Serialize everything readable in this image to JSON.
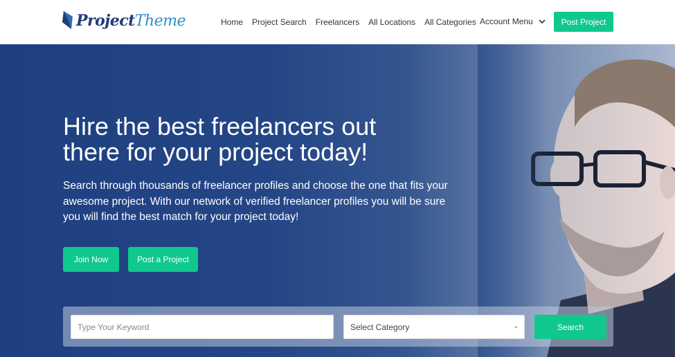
{
  "brand": {
    "name_part1": "Project",
    "name_part2": "Theme"
  },
  "nav": {
    "items": [
      {
        "label": "Home"
      },
      {
        "label": "Project Search"
      },
      {
        "label": "Freelancers"
      },
      {
        "label": "All Locations"
      },
      {
        "label": "All Categories"
      }
    ],
    "account_menu": "Account Menu",
    "post_project": "Post Project"
  },
  "hero": {
    "title": "Hire the best freelancers out there for your project today!",
    "subtitle": "Search through thousands of freelancer profiles and choose the one that fits your awesome project. With our network of verified freelancer profiles you will be sure you will find the best match for your project today!",
    "join_label": "Join Now",
    "post_label": "Post a Project"
  },
  "search": {
    "keyword_placeholder": "Type Your Keyword",
    "category_selected": "Select Category",
    "search_label": "Search"
  },
  "colors": {
    "accent": "#10c88e",
    "hero_blue": "#1e3f80"
  }
}
